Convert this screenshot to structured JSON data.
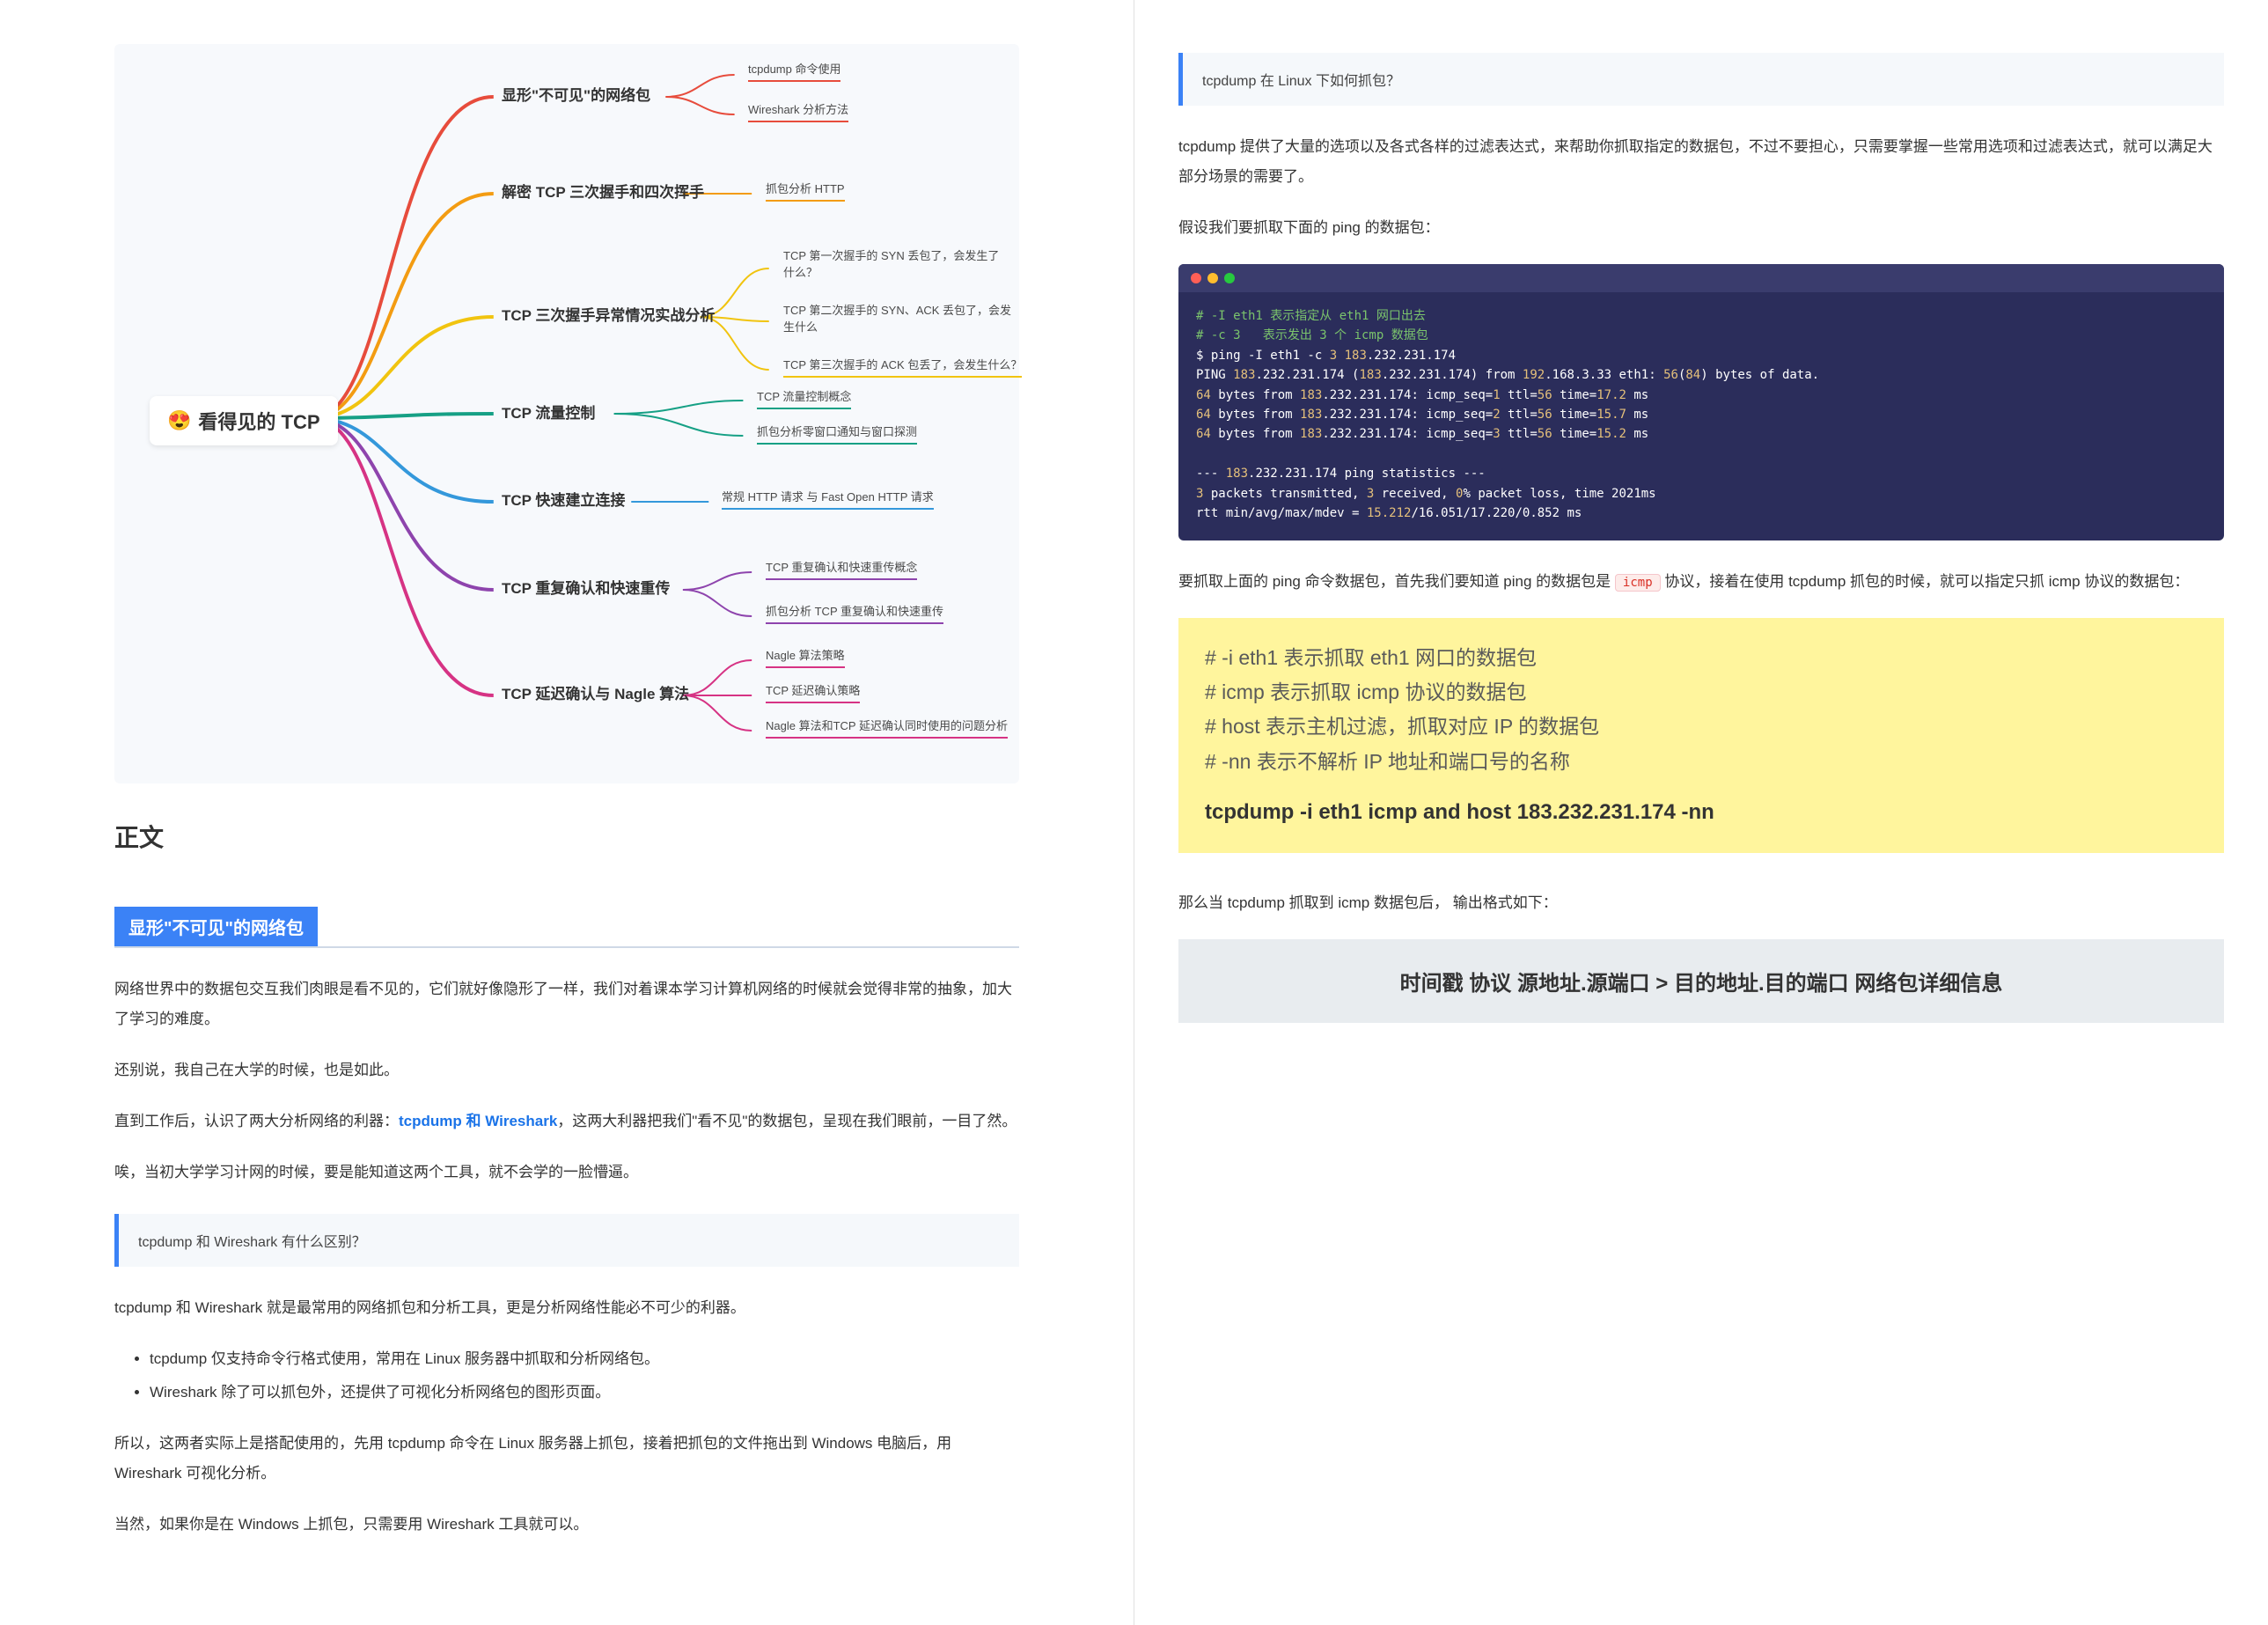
{
  "mindmap": {
    "root_emoji": "😍",
    "root_label": "看得见的 TCP",
    "branches": [
      {
        "label": "显形\"不可见\"的网络包",
        "color": "red",
        "leaves": [
          "tcpdump 命令使用",
          "Wireshark 分析方法"
        ]
      },
      {
        "label": "解密 TCP 三次握手和四次挥手",
        "color": "orange",
        "leaves": [
          "抓包分析 HTTP"
        ]
      },
      {
        "label": "TCP 三次握手异常情况实战分析",
        "color": "yellow",
        "leaves": [
          "TCP 第一次握手的 SYN 丢包了，会发生了什么？",
          "TCP 第二次握手的 SYN、ACK 丢包了，会发生什么",
          "TCP 第三次握手的 ACK 包丢了，会发生什么？"
        ]
      },
      {
        "label": "TCP 流量控制",
        "color": "teal",
        "leaves": [
          "TCP 流量控制概念",
          "抓包分析零窗口通知与窗口探测"
        ]
      },
      {
        "label": "TCP 快速建立连接",
        "color": "blue",
        "leaves": [
          "常规 HTTP 请求 与 Fast  Open HTTP 请求"
        ]
      },
      {
        "label": "TCP 重复确认和快速重传",
        "color": "purple",
        "leaves": [
          "TCP 重复确认和快速重传概念",
          "抓包分析 TCP 重复确认和快速重传"
        ]
      },
      {
        "label": "TCP 延迟确认与 Nagle 算法",
        "color": "pink",
        "leaves": [
          "Nagle 算法策略",
          "TCP 延迟确认策略",
          "Nagle 算法和TCP 延迟确认同时使用的问题分析"
        ]
      }
    ]
  },
  "left": {
    "h2": "正文",
    "section_title": "显形\"不可见\"的网络包",
    "p1": "网络世界中的数据包交互我们肉眼是看不见的，它们就好像隐形了一样，我们对着课本学习计算机网络的时候就会觉得非常的抽象，加大了学习的难度。",
    "p2": "还别说，我自己在大学的时候，也是如此。",
    "p3a": "直到工作后，认识了两大分析网络的利器：",
    "p3b": "tcpdump 和 Wireshark",
    "p3c": "，这两大利器把我们\"看不见\"的数据包，呈现在我们眼前，一目了然。",
    "p4": "唉，当初大学学习计网的时候，要是能知道这两个工具，就不会学的一脸懵逼。",
    "callout": "tcpdump 和 Wireshark 有什么区别？",
    "p5": "tcpdump 和 Wireshark 就是最常用的网络抓包和分析工具，更是分析网络性能必不可少的利器。",
    "li1": "tcpdump 仅支持命令行格式使用，常用在 Linux 服务器中抓取和分析网络包。",
    "li2": "Wireshark 除了可以抓包外，还提供了可视化分析网络包的图形页面。",
    "p6": "所以，这两者实际上是搭配使用的，先用 tcpdump 命令在 Linux 服务器上抓包，接着把抓包的文件拖出到 Windows 电脑后，用 Wireshark 可视化分析。",
    "p7": "当然，如果你是在 Windows 上抓包，只需要用 Wireshark 工具就可以。"
  },
  "right": {
    "callout": "tcpdump 在 Linux 下如何抓包？",
    "p1": "tcpdump 提供了大量的选项以及各式各样的过滤表达式，来帮助你抓取指定的数据包，不过不要担心，只需要掌握一些常用选项和过滤表达式，就可以满足大部分场景的需要了。",
    "p2": "假设我们要抓取下面的 ping 的数据包：",
    "terminal": {
      "c1": "# -I eth1 表示指定从 eth1 网口出去",
      "c2_a": "# -c 3",
      "c2_b": "   表示发出 3 个 icmp 数据包",
      "l3_a": "$ ping -I eth1 -c ",
      "l3_b": "3",
      "l3_c": " 183",
      "l3_d": ".232.231.174",
      "l4": "PING 183.232.231.174 (183.232.231.174) from 192.168.3.33 eth1: 56(84) bytes of data.",
      "b1": "64 bytes from 183.232.231.174: icmp_seq=1 ttl=56 time=17.2 ms",
      "b2": "64 bytes from 183.232.231.174: icmp_seq=2 ttl=56 time=15.7 ms",
      "b3": "64 bytes from 183.232.231.174: icmp_seq=3 ttl=56 time=15.2 ms",
      "s1": "--- 183.232.231.174 ping statistics ---",
      "s2": "3 packets transmitted, 3 received, 0% packet loss, time 2021ms",
      "s3": "rtt min/avg/max/mdev = 15.212/16.051/17.220/0.852 ms"
    },
    "p3a": "要抓取上面的 ping 命令数据包，首先我们要知道 ping 的数据包是 ",
    "p3code": "icmp",
    "p3b": " 协议，接着在使用 tcpdump 抓包的时候，就可以指定只抓 icmp 协议的数据包：",
    "yellow": {
      "c1": "#  -i eth1  表示抓取 eth1 网口的数据包",
      "c2": "#  icmp    表示抓取 icmp 协议的数据包",
      "c3": "#  host     表示主机过滤，抓取对应 IP 的数据包",
      "c4": "#  -nn       表示不解析 IP 地址和端口号的名称",
      "cmd": "tcpdump -i eth1 icmp and host 183.232.231.174 -nn"
    },
    "p4": "那么当 tcpdump 抓取到 icmp 数据包后， 输出格式如下：",
    "grey": "时间戳 协议 源地址.源端口 > 目的地址.目的端口 网络包详细信息"
  }
}
